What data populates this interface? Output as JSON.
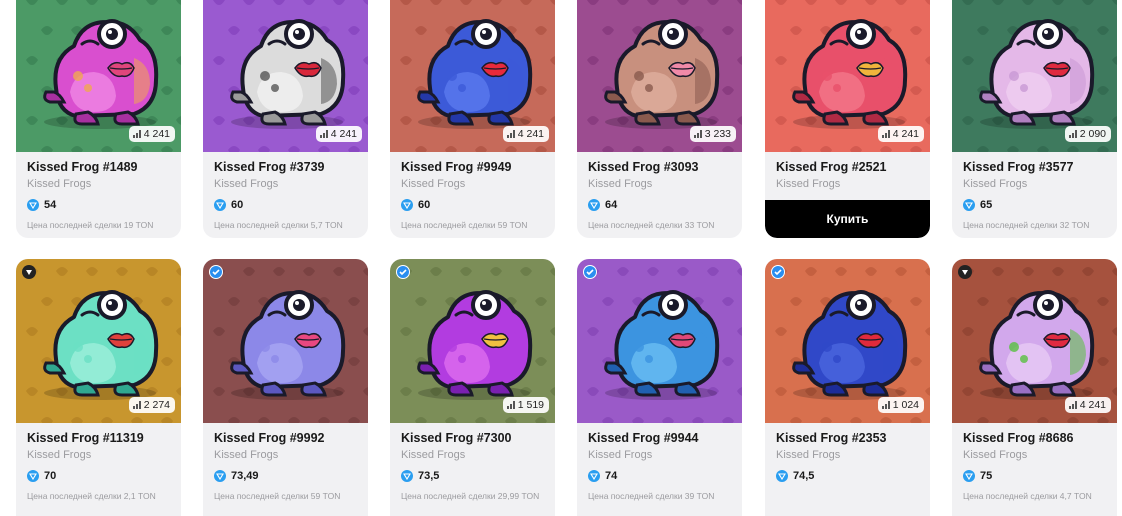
{
  "buy_label": "Купить",
  "cards": [
    {
      "title": "Kissed Frog #1489",
      "collection": "Kissed Frogs",
      "price": "54",
      "last_sale": "Цена последней сделки 19 TON",
      "count": "4 241",
      "bg": "#4c9a66",
      "pattern": "#3e8758",
      "frog": "#d94fcf",
      "frog_dark": "#a830a0",
      "belly": "#f08ae6",
      "lips": "#e0467c",
      "spots": "#f0a850",
      "badge": "",
      "buy": false
    },
    {
      "title": "Kissed Frog #3739",
      "collection": "Kissed Frogs",
      "price": "60",
      "last_sale": "Цена последней сделки 5,7 TON",
      "count": "4 241",
      "bg": "#9a5ad0",
      "pattern": "#8a48c2",
      "frog": "#dcdcdc",
      "frog_dark": "#9a9a9a",
      "belly": "#f3f3f3",
      "lips": "#d8283c",
      "spots": "#555555",
      "badge": "",
      "buy": false
    },
    {
      "title": "Kissed Frog #9949",
      "collection": "Kissed Frogs",
      "price": "60",
      "last_sale": "Цена последней сделки 59 TON",
      "count": "4 241",
      "bg": "#c66a5a",
      "pattern": "#b45848",
      "frog": "#3c5ad8",
      "frog_dark": "#2438a8",
      "belly": "#5c7cf0",
      "lips": "#e82a3c",
      "spots": "#3c5ad8",
      "badge": "",
      "buy": false
    },
    {
      "title": "Kissed Frog #3093",
      "collection": "Kissed Frogs",
      "price": "64",
      "last_sale": "Цена последней сделки 33 TON",
      "count": "3 233",
      "bg": "#9c4c90",
      "pattern": "#8a3c80",
      "frog": "#c8907e",
      "frog_dark": "#8a5a4e",
      "belly": "#e0b0a0",
      "lips": "#f08aa8",
      "spots": "#8a5a4e",
      "badge": "",
      "buy": false
    },
    {
      "title": "Kissed Frog #2521",
      "collection": "Kissed Frogs",
      "price": "",
      "last_sale": "",
      "count": "4 241",
      "bg": "#e86a5e",
      "pattern": "#d45a50",
      "frog": "#e8506a",
      "frog_dark": "#b02a44",
      "belly": "#f47a8c",
      "lips": "#f0b43c",
      "spots": "#e8506a",
      "badge": "",
      "buy": true
    },
    {
      "title": "Kissed Frog #3577",
      "collection": "Kissed Frogs",
      "price": "65",
      "last_sale": "Цена последней сделки 32 TON",
      "count": "2 090",
      "bg": "#3e7a5e",
      "pattern": "#346c52",
      "frog": "#e4b8e8",
      "frog_dark": "#b080c0",
      "belly": "#f0d0f2",
      "lips": "#e02a40",
      "spots": "#c898d4",
      "badge": "",
      "buy": false
    },
    {
      "title": "Kissed Frog #11319",
      "collection": "Kissed Frogs",
      "price": "70",
      "last_sale": "Цена последней сделки 2,1 TON",
      "count": "2 274",
      "bg": "#c8962e",
      "pattern": "#b88626",
      "frog": "#6ce0c4",
      "frog_dark": "#30a890",
      "belly": "#a0f0dc",
      "lips": "#e0403c",
      "spots": "#6ce0c4",
      "badge": "dark",
      "buy": false
    },
    {
      "title": "Kissed Frog #9992",
      "collection": "Kissed Frogs",
      "price": "73,49",
      "last_sale": "Цена последней сделки 59 TON",
      "count": "",
      "bg": "#8a4e4e",
      "pattern": "#7a4242",
      "frog": "#8c88e8",
      "frog_dark": "#5c58c0",
      "belly": "#aaa8f4",
      "lips": "#e84880",
      "spots": "#8c88e8",
      "badge": "blue",
      "buy": false
    },
    {
      "title": "Kissed Frog #7300",
      "collection": "Kissed Frogs",
      "price": "73,5",
      "last_sale": "Цена последней сделки 29,99 TON",
      "count": "1 519",
      "bg": "#7c8e58",
      "pattern": "#6c7e4a",
      "frog": "#b23ce0",
      "frog_dark": "#7a20b0",
      "belly": "#e070f0",
      "lips": "#f0c040",
      "spots": "#b23ce0",
      "badge": "blue",
      "buy": false
    },
    {
      "title": "Kissed Frog #9944",
      "collection": "Kissed Frogs",
      "price": "74",
      "last_sale": "Цена последней сделки 39 TON",
      "count": "",
      "bg": "#9a5ac8",
      "pattern": "#8a4aba",
      "frog": "#3c94e0",
      "frog_dark": "#2060b0",
      "belly": "#6cc0f4",
      "lips": "#e04878",
      "spots": "#3c94e0",
      "badge": "blue",
      "buy": false
    },
    {
      "title": "Kissed Frog #2353",
      "collection": "Kissed Frogs",
      "price": "74,5",
      "last_sale": "",
      "count": "1 024",
      "bg": "#d8704e",
      "pattern": "#c46040",
      "frog": "#3048c8",
      "frog_dark": "#1c2c98",
      "belly": "#4c68e0",
      "lips": "#e02a3c",
      "spots": "#3048c8",
      "badge": "blue",
      "buy": false
    },
    {
      "title": "Kissed Frog #8686",
      "collection": "Kissed Frogs",
      "price": "75",
      "last_sale": "Цена последней сделки 4,7 TON",
      "count": "4 241",
      "bg": "#a6523e",
      "pattern": "#944634",
      "frog": "#d2a8ec",
      "frog_dark": "#9a70c4",
      "belly": "#e8ccf6",
      "lips": "#e02a40",
      "spots": "#58c040",
      "badge": "dark",
      "buy": false
    }
  ]
}
